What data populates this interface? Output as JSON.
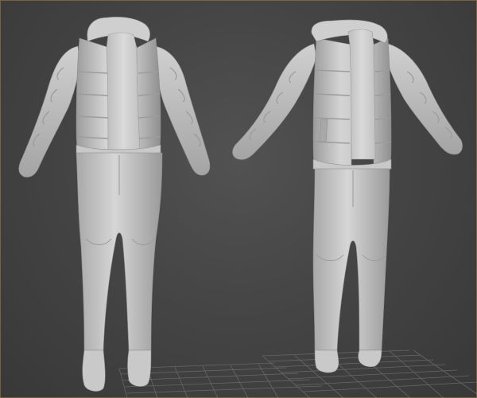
{
  "app": {
    "view": "3d-perspective-viewport",
    "shading": "clay"
  },
  "colors": {
    "background_center": "#525252",
    "background_edge": "#383838",
    "grid_line": "#6b6b6b",
    "clay_light": "#d2d2d2",
    "clay_mid": "#b8b8b8",
    "clay_shadow": "#8e8e8e",
    "viewport_border": "#e8a93a"
  },
  "scene": {
    "objects": [
      {
        "id": "outfit-left",
        "items": [
          "hooded-puffer-jacket-open",
          "t-shirt",
          "slim-jeans",
          "sneakers"
        ]
      },
      {
        "id": "outfit-right",
        "items": [
          "hooded-puffer-vest-jacket",
          "t-shirt",
          "straight-pants",
          "sneakers"
        ]
      }
    ],
    "ground_grid": true
  }
}
